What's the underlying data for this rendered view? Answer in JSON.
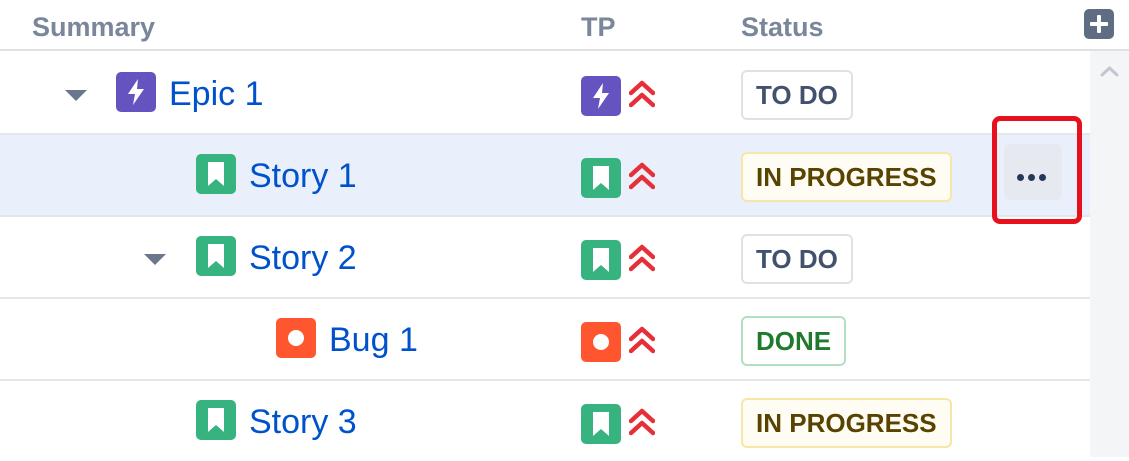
{
  "header": {
    "summary_label": "Summary",
    "tp_label": "TP",
    "status_label": "Status",
    "add_icon": "plus-square-icon"
  },
  "colors": {
    "epic": "#6554c0",
    "story": "#36b37e",
    "bug": "#ff5630",
    "priority": "#e5303a",
    "link": "#0052cc",
    "highlight": "#e8101d"
  },
  "rows": [
    {
      "type": "epic",
      "title": "Epic 1",
      "status": "TO DO",
      "status_kind": "todo",
      "expanded": true,
      "priority_icon": "highest-priority-icon"
    },
    {
      "type": "story",
      "title": "Story 1",
      "status": "IN PROGRESS",
      "status_kind": "inprogress",
      "selected": true,
      "priority_icon": "highest-priority-icon"
    },
    {
      "type": "story",
      "title": "Story 2",
      "status": "TO DO",
      "status_kind": "todo",
      "expanded": true,
      "priority_icon": "highest-priority-icon"
    },
    {
      "type": "bug",
      "title": "Bug 1",
      "status": "DONE",
      "status_kind": "done",
      "priority_icon": "highest-priority-icon"
    },
    {
      "type": "story",
      "title": "Story 3",
      "status": "IN PROGRESS",
      "status_kind": "inprogress",
      "priority_icon": "highest-priority-icon"
    }
  ],
  "row_actions": {
    "more_icon": "more-horizontal-icon"
  }
}
